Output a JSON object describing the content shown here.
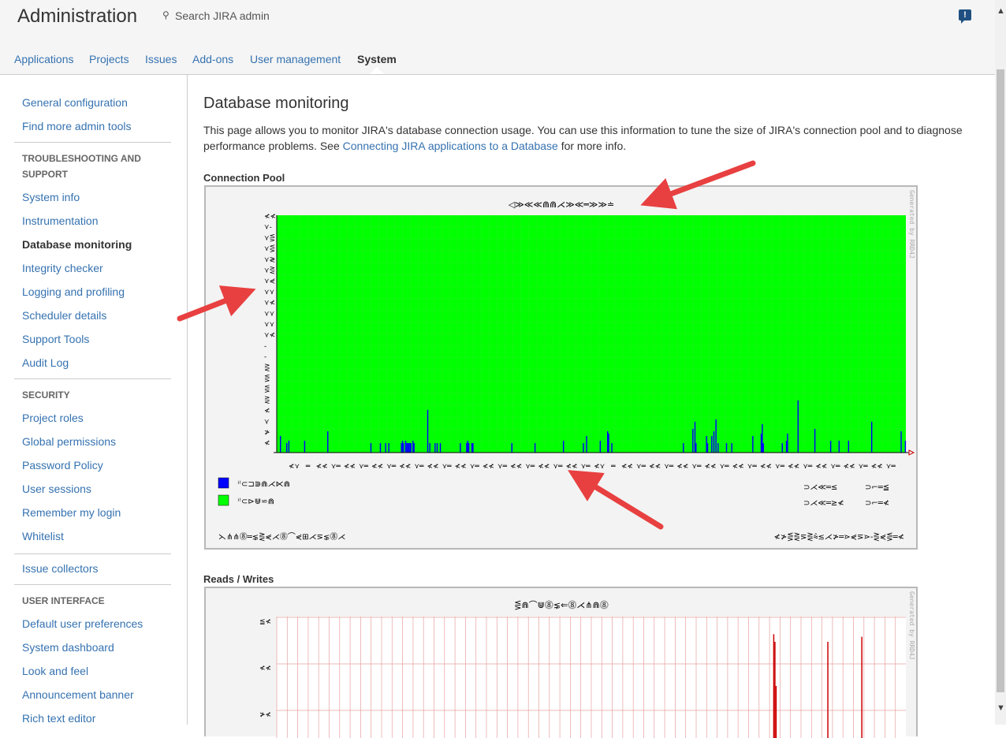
{
  "header": {
    "title": "Administration",
    "search_placeholder": "Search JIRA admin",
    "feedback_icon": "!"
  },
  "tabs": [
    {
      "label": "Applications"
    },
    {
      "label": "Projects"
    },
    {
      "label": "Issues"
    },
    {
      "label": "Add-ons"
    },
    {
      "label": "User management"
    },
    {
      "label": "System"
    }
  ],
  "sidebar": {
    "items": [
      "General configuration",
      "Find more admin tools",
      "System info",
      "Instrumentation",
      "Database monitoring",
      "Integrity checker",
      "Logging and profiling",
      "Scheduler details",
      "Support Tools",
      "Audit Log",
      "Project roles",
      "Global permissions",
      "Password Policy",
      "User sessions",
      "Remember my login",
      "Whitelist",
      "Issue collectors",
      "Default user preferences",
      "System dashboard",
      "Look and feel",
      "Announcement banner",
      "Rich text editor"
    ],
    "headings": [
      "Troubleshooting and Support",
      "Security",
      "User Interface"
    ]
  },
  "main": {
    "title": "Database monitoring",
    "intro_before": "This page allows you to monitor JIRA's database connection usage. You can use this information to tune the size of JIRA's connection pool and to diagnose performance problems. See ",
    "intro_link": "Connecting JIRA applications to a Database",
    "intro_after": " for more info.",
    "section1": "Connection Pool",
    "section2": "Reads / Writes"
  },
  "chart_data": [
    {
      "type": "bar",
      "title": "◁≫≪≪⋒⋒⋌≫≪═≫≫≐",
      "watermark": "Generated by RRD4J",
      "background_color": "#00ff00",
      "bar_color": "#0000ff",
      "series": [
        {
          "name": "ꜞꜝ⊂⊐⋑⋒⋌⋉⋒",
          "color": "#0000ff"
        },
        {
          "name": "ꜞꜝ⊂⊳⋓⋍⋒",
          "color": "#00ff00"
        }
      ],
      "legend_values": [
        [
          "⊃⋌≪═≤",
          "⊃⌐═≦"
        ],
        [
          "⊃⋌≪═≥≮",
          "⊃⌐═≮"
        ]
      ],
      "footer_left": "⋋⋔⋔⓼═⋦⋛⋞⋌⓼⌒⋞⊞⋌⋝⋦⓼⋌",
      "footer_right": "≮≯⋚⋛⋝⋛⩯≲⋌≯═⋗⋞⋝⋗-⋛⋞⋚═≮",
      "ylim": [
        0,
        100
      ],
      "values": [
        0,
        0,
        0,
        7,
        0,
        0,
        0,
        0,
        0,
        4,
        0,
        5,
        0,
        0,
        0,
        0,
        0,
        0,
        0,
        0,
        0,
        0,
        0,
        0,
        0,
        0,
        5,
        0,
        0,
        0,
        0,
        0,
        0,
        0,
        0,
        0,
        0,
        0,
        0,
        0,
        0,
        0,
        0,
        0,
        0,
        0,
        0,
        0,
        9,
        0,
        0,
        0,
        0,
        0,
        0,
        0,
        0,
        0,
        0,
        0,
        0,
        0,
        0,
        0,
        0,
        0,
        0,
        0,
        0,
        0,
        0,
        0,
        0,
        0,
        0,
        0,
        0,
        0,
        0,
        0,
        0,
        0,
        0,
        0,
        0,
        0,
        0,
        0,
        0,
        4,
        0,
        0,
        0,
        0,
        0,
        0,
        0,
        0,
        4,
        0,
        0,
        0,
        0,
        4,
        0,
        0,
        4,
        0,
        0,
        0,
        0,
        0,
        0,
        0,
        0,
        0,
        0,
        0,
        4,
        5,
        4,
        0,
        5,
        4,
        4,
        4,
        4,
        4,
        0,
        5,
        4,
        0,
        0,
        0,
        0,
        0,
        0,
        0,
        0,
        0,
        0,
        0,
        0,
        18,
        0,
        4,
        0,
        0,
        0,
        0,
        4,
        0,
        4,
        0,
        0,
        4,
        0,
        0,
        0,
        0,
        0,
        0,
        0,
        0,
        0,
        0,
        0,
        0,
        0,
        0,
        0,
        0,
        0,
        0,
        4,
        0,
        0,
        0,
        0,
        0,
        4,
        5,
        4,
        0,
        0,
        4,
        4,
        0,
        0,
        0,
        0,
        0,
        0,
        0,
        0,
        0,
        0,
        0,
        0,
        0,
        0,
        0,
        0,
        0,
        0,
        0,
        0,
        0,
        0,
        0,
        0,
        0,
        0,
        0,
        0,
        0,
        0,
        0,
        0,
        0,
        0,
        0,
        0,
        4,
        0,
        0,
        0,
        0,
        0,
        0,
        0,
        0,
        0,
        0,
        0,
        0,
        0,
        0,
        0,
        0,
        0,
        0,
        0,
        0,
        0,
        4,
        0,
        0,
        0,
        0,
        0,
        0,
        0,
        0,
        0,
        0,
        0,
        0,
        0,
        0,
        0,
        0,
        0,
        0,
        0,
        0,
        0,
        0,
        0,
        0,
        0,
        0,
        5,
        0,
        0,
        0,
        0,
        0,
        0,
        0,
        0,
        0,
        0,
        0,
        0,
        0,
        0,
        0,
        0,
        0,
        0,
        4,
        0,
        0,
        7,
        0,
        0,
        0,
        0,
        0,
        0,
        0,
        0,
        0,
        0,
        0,
        0,
        5,
        0,
        0,
        0,
        0,
        0,
        0,
        9,
        8,
        0,
        0,
        4,
        0,
        0,
        0,
        0,
        0,
        0,
        0,
        0,
        0,
        0,
        0,
        0,
        0,
        0,
        0,
        0,
        0,
        0,
        0,
        0,
        0,
        0,
        0,
        0,
        0,
        0,
        0,
        0,
        0,
        0,
        0,
        0,
        0,
        0,
        0,
        0,
        0,
        0,
        0,
        0,
        0,
        0,
        0,
        0,
        0,
        0,
        0,
        0,
        0,
        0,
        0,
        0,
        0,
        0,
        0,
        0,
        0,
        0,
        0,
        0,
        0,
        0,
        0,
        0,
        0,
        0,
        0,
        4,
        0,
        0,
        0,
        0,
        0,
        0,
        0,
        0,
        10,
        0,
        13,
        4,
        0,
        0,
        0,
        0,
        0,
        0,
        0,
        0,
        0,
        7,
        4,
        0,
        0,
        0,
        7,
        0,
        9,
        0,
        14,
        0,
        4,
        0,
        0,
        0,
        0,
        0,
        0,
        0,
        4,
        0,
        0,
        0,
        0,
        4,
        0,
        0,
        0,
        0,
        0,
        0,
        0,
        0,
        0,
        0,
        0,
        0,
        0,
        0,
        0,
        0,
        0,
        0,
        0,
        7,
        0,
        0,
        0,
        0,
        0,
        0,
        0,
        8,
        12,
        4,
        0,
        0,
        0,
        0,
        0,
        0,
        0,
        0,
        0,
        0,
        0,
        0,
        0,
        0,
        0,
        0,
        0,
        4,
        0,
        0,
        0,
        5,
        8,
        0,
        0,
        0,
        0,
        0,
        0,
        0,
        0,
        0,
        22,
        0,
        0,
        0,
        0,
        0,
        0,
        0,
        0,
        0,
        0,
        0,
        0,
        0,
        0,
        0,
        10,
        0,
        0,
        0,
        0,
        0,
        0,
        0,
        0,
        0,
        0,
        0,
        0,
        0,
        0,
        5,
        0,
        0,
        0,
        0,
        0,
        0,
        0,
        5,
        0,
        0,
        0,
        0,
        0,
        0,
        0,
        0,
        5,
        0,
        0,
        0,
        0,
        0,
        0,
        0,
        0,
        0,
        0,
        0,
        0,
        0,
        0,
        0,
        0,
        0,
        0,
        0,
        0,
        0,
        13,
        0,
        0,
        0,
        0,
        0,
        0,
        0,
        0,
        0,
        0,
        0,
        0,
        0,
        0,
        0,
        0,
        0,
        0,
        0,
        0,
        0,
        0,
        0,
        0,
        0,
        0,
        0,
        9,
        0,
        0,
        0,
        5
      ]
    },
    {
      "type": "line",
      "title": "⋚⋒⌒⋓⓼⋦⇐⓼⋌⋔⋒⓼",
      "watermark": "Generated by RRD4J",
      "line_color": "#cc0000",
      "grid_color": "#e8a0a0",
      "spikes": [
        {
          "x": 0.79,
          "values": [
            0.86,
            0.8,
            0.45
          ]
        },
        {
          "x": 0.876,
          "values": [
            0.8
          ]
        },
        {
          "x": 0.93,
          "values": [
            0.84
          ]
        }
      ]
    }
  ],
  "annotations": {
    "arrow_color": "#e84040"
  }
}
